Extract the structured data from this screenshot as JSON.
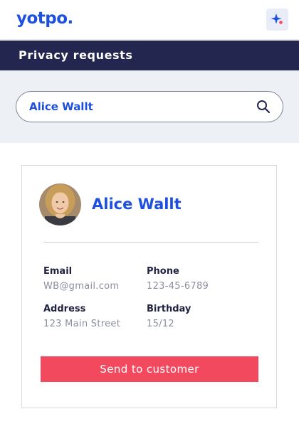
{
  "header": {
    "logo_text": "yotpo.",
    "brand_color": "#1d4fe0",
    "action_icon": "sparkle-icon"
  },
  "navbar": {
    "title": "Privacy requests",
    "background": "#23264f"
  },
  "search": {
    "value": "Alice Wallt",
    "icon": "search-icon"
  },
  "customer": {
    "name": "Alice Wallt",
    "avatar_icon": "avatar-photo",
    "fields": {
      "email": {
        "label": "Email",
        "value": "WB@gmail.com"
      },
      "phone": {
        "label": "Phone",
        "value": "123-45-6789"
      },
      "address": {
        "label": "Address",
        "value": "123 Main Street"
      },
      "birthday": {
        "label": "Birthday",
        "value": "15/12"
      }
    }
  },
  "actions": {
    "send_label": "Send to customer",
    "send_color": "#f2495f"
  }
}
